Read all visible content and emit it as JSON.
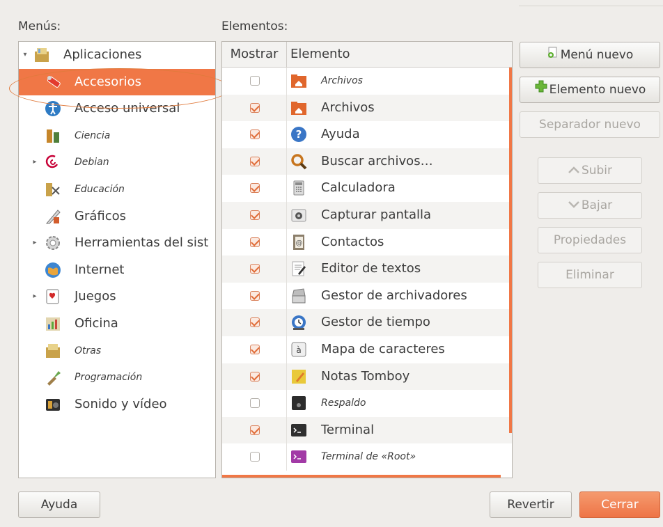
{
  "menus_label": "Menús:",
  "elements_label": "Elementos:",
  "menus": [
    {
      "label": "Aplicaciones",
      "icon": "applications-folder-icon",
      "expander": "▾",
      "italic": false,
      "indent": 0,
      "selected": false
    },
    {
      "label": "Accesorios",
      "icon": "accessories-icon",
      "expander": "",
      "italic": false,
      "indent": 1,
      "selected": true
    },
    {
      "label": "Acceso universal",
      "icon": "universal-access-icon",
      "expander": "",
      "italic": false,
      "indent": 1,
      "selected": false
    },
    {
      "label": "Ciencia",
      "icon": "science-icon",
      "expander": "",
      "italic": true,
      "indent": 1,
      "selected": false
    },
    {
      "label": "Debian",
      "icon": "debian-icon",
      "expander": "▸",
      "italic": true,
      "indent": 1,
      "selected": false
    },
    {
      "label": "Educación",
      "icon": "education-icon",
      "expander": "",
      "italic": true,
      "indent": 1,
      "selected": false
    },
    {
      "label": "Gráficos",
      "icon": "graphics-icon",
      "expander": "",
      "italic": false,
      "indent": 1,
      "selected": false
    },
    {
      "label": "Herramientas del sist",
      "icon": "system-tools-icon",
      "expander": "▸",
      "italic": false,
      "indent": 1,
      "selected": false
    },
    {
      "label": "Internet",
      "icon": "internet-icon",
      "expander": "",
      "italic": false,
      "indent": 1,
      "selected": false
    },
    {
      "label": "Juegos",
      "icon": "games-icon",
      "expander": "▸",
      "italic": false,
      "indent": 1,
      "selected": false
    },
    {
      "label": "Oficina",
      "icon": "office-icon",
      "expander": "",
      "italic": false,
      "indent": 1,
      "selected": false
    },
    {
      "label": "Otras",
      "icon": "other-icon",
      "expander": "",
      "italic": true,
      "indent": 1,
      "selected": false
    },
    {
      "label": "Programación",
      "icon": "programming-icon",
      "expander": "",
      "italic": true,
      "indent": 1,
      "selected": false
    },
    {
      "label": "Sonido y vídeo",
      "icon": "sound-video-icon",
      "expander": "",
      "italic": false,
      "indent": 1,
      "selected": false
    }
  ],
  "table": {
    "col_show": "Mostrar",
    "col_element": "Elemento",
    "rows": [
      {
        "label": "Archivos",
        "checked": false,
        "italic": true,
        "icon": "home-folder-icon",
        "icon_color": "#e0662c"
      },
      {
        "label": "Archivos",
        "checked": true,
        "italic": false,
        "icon": "home-folder-icon",
        "icon_color": "#e0662c"
      },
      {
        "label": "Ayuda",
        "checked": true,
        "italic": false,
        "icon": "help-icon",
        "icon_color": "#3a76c6"
      },
      {
        "label": "Buscar archivos…",
        "checked": true,
        "italic": false,
        "icon": "search-icon",
        "icon_color": "#c7751e"
      },
      {
        "label": "Calculadora",
        "checked": true,
        "italic": false,
        "icon": "calculator-icon",
        "icon_color": "#8a8a8a"
      },
      {
        "label": "Capturar pantalla",
        "checked": true,
        "italic": false,
        "icon": "camera-icon",
        "icon_color": "#9a9a9a"
      },
      {
        "label": "Contactos",
        "checked": true,
        "italic": false,
        "icon": "contacts-icon",
        "icon_color": "#8b7e6a"
      },
      {
        "label": "Editor de textos",
        "checked": true,
        "italic": false,
        "icon": "text-editor-icon",
        "icon_color": "#d8d8d8"
      },
      {
        "label": "Gestor de archivadores",
        "checked": true,
        "italic": false,
        "icon": "archive-manager-icon",
        "icon_color": "#8a8a8a"
      },
      {
        "label": "Gestor de tiempo",
        "checked": true,
        "italic": false,
        "icon": "time-tracker-icon",
        "icon_color": "#3a76c6"
      },
      {
        "label": "Mapa de caracteres",
        "checked": true,
        "italic": false,
        "icon": "character-map-icon",
        "icon_color": "#c9c4b8"
      },
      {
        "label": "Notas Tomboy",
        "checked": true,
        "italic": false,
        "icon": "notes-icon",
        "icon_color": "#e9c93a"
      },
      {
        "label": "Respaldo",
        "checked": false,
        "italic": true,
        "icon": "backup-icon",
        "icon_color": "#2c2c2c"
      },
      {
        "label": "Terminal",
        "checked": true,
        "italic": false,
        "icon": "terminal-icon",
        "icon_color": "#2f2f2f"
      },
      {
        "label": "Terminal de «Root»",
        "checked": false,
        "italic": true,
        "icon": "root-terminal-icon",
        "icon_color": "#a23aa6"
      }
    ]
  },
  "buttons": {
    "new_menu": "Menú nuevo",
    "new_item": "Elemento nuevo",
    "new_separator": "Separador nuevo",
    "move_up": "Subir",
    "move_down": "Bajar",
    "properties": "Propiedades",
    "delete": "Eliminar",
    "help": "Ayuda",
    "revert": "Revertir",
    "close": "Cerrar"
  },
  "colors": {
    "accent": "#f07746",
    "selection": "#f07746",
    "annotation": "#e07a3c"
  }
}
